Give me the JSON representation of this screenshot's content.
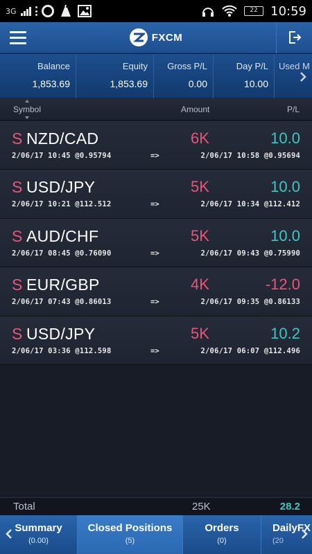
{
  "status_bar": {
    "network": "3G",
    "battery": "22",
    "time": "10:59"
  },
  "header": {
    "brand": "FXCM"
  },
  "account": {
    "balance": {
      "label": "Balance",
      "value": "1,853.69"
    },
    "equity": {
      "label": "Equity",
      "value": "1,853.69"
    },
    "gross_pl": {
      "label": "Gross P/L",
      "value": "0.00"
    },
    "day_pl": {
      "label": "Day P/L",
      "value": "10.00"
    },
    "used_margin": {
      "label": "Used M"
    }
  },
  "columns": {
    "symbol": "Symbol",
    "amount": "Amount",
    "pl": "P/L"
  },
  "positions": [
    {
      "side": "S",
      "pair": "NZD/CAD",
      "amount": "6K",
      "pl": "10.0",
      "open": "2/06/17 10:45 @0.95794",
      "arrow": "=>",
      "close": "2/06/17 10:58 @0.95694"
    },
    {
      "side": "S",
      "pair": "USD/JPY",
      "amount": "5K",
      "pl": "10.0",
      "open": "2/06/17 10:21 @112.512",
      "arrow": "=>",
      "close": "2/06/17 10:34 @112.412"
    },
    {
      "side": "S",
      "pair": "AUD/CHF",
      "amount": "5K",
      "pl": "10.0",
      "open": "2/06/17 08:45 @0.76090",
      "arrow": "=>",
      "close": "2/06/17 09:43 @0.75990"
    },
    {
      "side": "S",
      "pair": "EUR/GBP",
      "amount": "4K",
      "pl": "-12.0",
      "open": "2/06/17 07:43 @0.86013",
      "arrow": "=>",
      "close": "2/06/17 09:35 @0.86133"
    },
    {
      "side": "S",
      "pair": "USD/JPY",
      "amount": "5K",
      "pl": "10.2",
      "open": "2/06/17 03:36 @112.598",
      "arrow": "=>",
      "close": "2/06/17 06:07 @112.496"
    }
  ],
  "totals": {
    "label": "Total",
    "amount": "25K",
    "pl": "28.2"
  },
  "tabs": [
    {
      "label": "Summary",
      "count": "(0.00)"
    },
    {
      "label": "Closed Positions",
      "count": "(5)"
    },
    {
      "label": "Orders",
      "count": "(0)"
    },
    {
      "label": "DailyFX",
      "count": "(20"
    }
  ],
  "colors": {
    "positive": "#3fc6c2",
    "negative": "#e8557a",
    "header_blue": "#2b63a8"
  }
}
